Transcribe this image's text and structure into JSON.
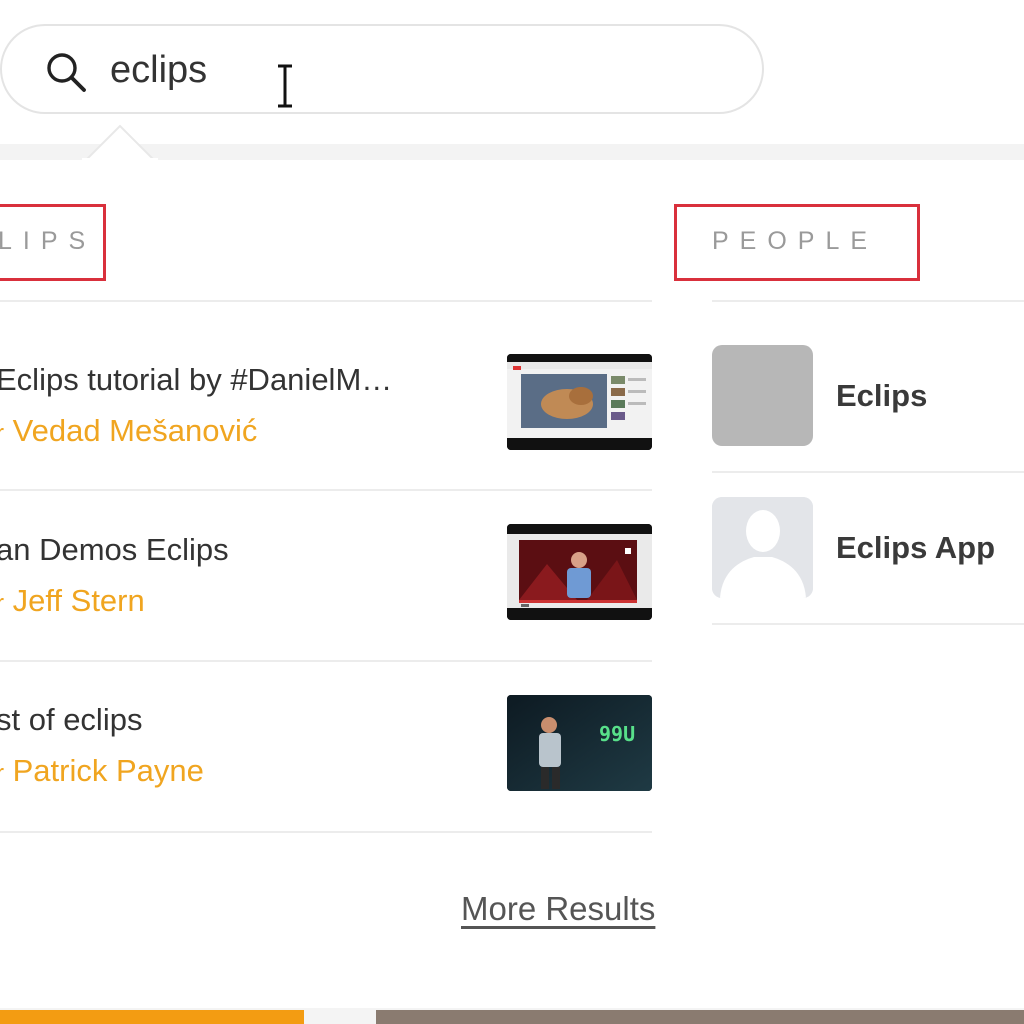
{
  "search": {
    "value": "eclips",
    "icon": "search-icon"
  },
  "clips_section": {
    "label": "LIPS",
    "items": [
      {
        "title": "Eclips tutorial by #DanielM…",
        "author_prefix": "r",
        "author": "Vedad Mešanović",
        "thumb_icon": "video-thumbnail"
      },
      {
        "title": "an Demos Eclips",
        "author_prefix": "r",
        "author": "Jeff Stern",
        "thumb_icon": "video-thumbnail"
      },
      {
        "title": "st of eclips",
        "author_prefix": "r",
        "author": "Patrick Payne",
        "thumb_icon": "video-thumbnail",
        "thumb_text": "99U"
      }
    ]
  },
  "people_section": {
    "label": "PEOPLE",
    "items": [
      {
        "name": "Eclips",
        "avatar": "gray-avatar"
      },
      {
        "name": "Eclips App",
        "avatar": "default-user-avatar"
      }
    ]
  },
  "more_results": "More Results",
  "colors": {
    "author": "#f0a520",
    "highlight_box": "#d9303c",
    "footer_orange": "#f39c12"
  }
}
